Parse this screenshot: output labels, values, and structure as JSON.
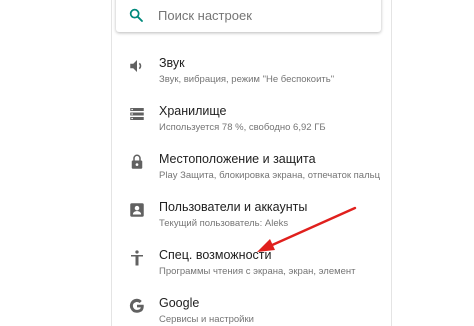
{
  "search": {
    "placeholder": "Поиск настроек"
  },
  "settings": [
    {
      "id": "sound",
      "icon": "volume-icon",
      "title": "Звук",
      "subtitle": "Звук, вибрация, режим \"Не беспокоить\""
    },
    {
      "id": "storage",
      "icon": "storage-icon",
      "title": "Хранилище",
      "subtitle": "Используется 78 %, свободно 6,92 ГБ"
    },
    {
      "id": "location-security",
      "icon": "lock-icon",
      "title": "Местоположение и защита",
      "subtitle": "Play Защита, блокировка экрана, отпечаток пальц"
    },
    {
      "id": "users-accounts",
      "icon": "account-box-icon",
      "title": "Пользователи и аккаунты",
      "subtitle": "Текущий пользователь: Aleks"
    },
    {
      "id": "accessibility",
      "icon": "accessibility-icon",
      "title": "Спец. возможности",
      "subtitle": "Программы чтения с экрана, экран, элемент"
    },
    {
      "id": "google",
      "icon": "google-icon",
      "title": "Google",
      "subtitle": "Сервисы и настройки"
    }
  ],
  "colors": {
    "accent": "#00897b",
    "icon": "#616161",
    "arrow": "#e0201d"
  }
}
